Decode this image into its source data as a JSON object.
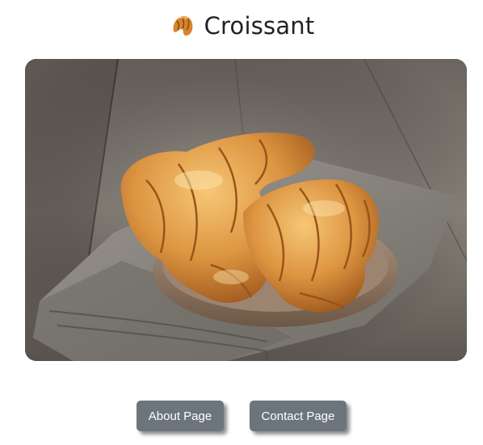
{
  "header": {
    "emoji_icon": "croissant-emoji-icon",
    "title": "Croissant"
  },
  "hero": {
    "image_subject": "croissants-on-plate-photo"
  },
  "buttons": {
    "about_label": "About Page",
    "contact_label": "Contact Page"
  },
  "colors": {
    "button_bg": "#6c757d",
    "button_text": "#ffffff",
    "title_text": "#222222"
  }
}
